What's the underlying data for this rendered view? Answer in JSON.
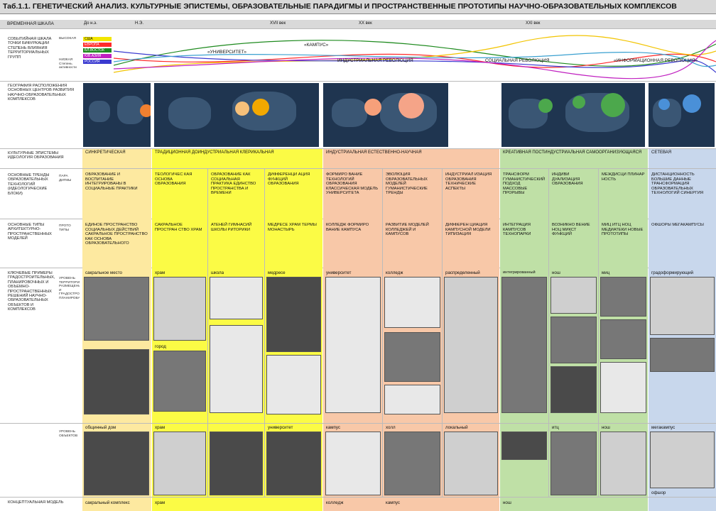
{
  "title": "Таб.1.1. ГЕНЕТИЧЕСКИЙ АНАЛИЗ. КУЛЬТУРНЫЕ ЭПИСТЕМЫ, ОБРАЗОВАТЕЛЬНЫЕ ПАРАДИГМЫ И ПРОСТРАНСТВЕННЫЕ ПРОТОТИПЫ НАУЧНО-ОБРАЗОВАТЕЛЬНЫХ КОМПЛЕКСОВ",
  "timescale": {
    "label": "ВРЕМЕННАЯ ШКАЛА",
    "marks": [
      "До н.э.",
      "Н.Э.",
      "XVII век",
      "XX век",
      "XXI век"
    ]
  },
  "rows": {
    "event": "СОБЫТИЙНАЯ ШКАЛА ТОЧКИ БИФУРКАЦИИ СТЕПЕНЬ ВЛИЯНИЯ ТЕРРИТОРИАЛЬНЫХ ГРУПП",
    "event_high": "ВЫСОКАЯ",
    "event_low": "НИЗКАЯ Степень активности",
    "geo": "ГЕОГРАФИЯ РАСПОЛОЖЕНИЯ ОСНОВНЫХ ЦЕНТРОВ РАЗВИТИЯ НАУЧНО-ОБРАЗОВАТЕЛЬНЫХ КОМПЛЕКСОВ",
    "episteme": "КУЛЬТУРНЫЕ ЭПИСТЕМЫ ИДЕОЛОГИЯ ОБРАЗОВАНИЯ",
    "trends": "ОСНОВНЫЕ ТРЕНДЫ ОБРАЗОВАТЕЛЬНЫХ ТЕХНОЛОГИЙ (ИДЕОЛОГИЧЕСКИЕ БЛОКИ)",
    "trends_sub": "ПАРА ДИГМЫ",
    "types": "ОСНОВНЫЕ ТИПЫ АРХИТЕКТУРНО-ПРОСТРАНСТВЕННЫХ МОДЕЛЕЙ",
    "types_sub": "ПРОТО ТИПЫ",
    "examples": "КЛЮЧЕВЫЕ ПРИМЕРЫ ГРАДОСТРОИТЕЛЬНЫХ, ПЛАНИРОВОЧНЫХ И ОБЪЕМНО-ПРОСТРАНСТВЕННЫХ РЕШЕНИЙ НАУЧНО-ОБРАЗОВАТЕЛЬНЫХ ОБЪЕКТОВ И КОМПЛЕКСОВ",
    "examples_sub1": "УРОВЕНЬ ТЕРРИТОРИАЛЬНОГО РАЗМЕЩЕНИЯ И ГРАДОСТРОИТЕЛЬНОГО ПЛАНИРОВАНИЯ",
    "examples_sub2": "УРОВЕНЬ ОБЪЕКТОВ",
    "concept": "КОНЦЕПТУАЛЬНАЯ МОДЕЛЬ"
  },
  "legend": [
    "США",
    "ЕВРОПА",
    "БЛ.ВОСТОК",
    "ЮВ.АЗИЯ",
    "РОССИЯ"
  ],
  "legend_colors": [
    "#f2e600",
    "#ff2a2a",
    "#1e8a1e",
    "#c020c0",
    "#3a3ad0"
  ],
  "event_labels": [
    "«УНИВЕРСИТЕТ»",
    "«КАМПУС»",
    "ИНДУСТРИАЛЬНАЯ РЕВОЛЮЦИЯ",
    "СОЦИАЛЬНАЯ РЕВОЛЮЦИЯ",
    "«ИНФОРМАЦИОННАЯ РЕВОЛЮЦИЯ»"
  ],
  "epistemes": [
    "СИНКРЕТИЧЕСКАЯ",
    "ТРАДИЦИОННАЯ ДОИНДУСТРИАЛЬНАЯ КЛЕРИКАЛЬНАЯ",
    "ИНДУСТРИАЛЬНАЯ ЕСТЕСТВЕННО-НАУЧНАЯ",
    "КРЕАТИВНАЯ ПОСТИНДУСТРИАЛЬНАЯ САМООРГАНИЗУЮЩАЯСЯ",
    "СЕТЕВАЯ"
  ],
  "trends": [
    "ОБРАЗОВАНИЕ И ВОСПИТАНИЕ ИНТЕГРИРОВАНЫ В СОЦИАЛЬНЫЕ ПРАКТИКИ",
    "ТЕОЛОГИЧЕС КАЯ ОСНОВА ОБРАЗОВАНИЯ",
    "ОБРАЗОВАНИЕ КАК СОЦИАЛЬНАЯ ПРАКТИКА ЕДИНСТВО ПРОСТРАНСТВА И ВРЕМЕНИ",
    "ДИФФЕРЕНЦИ АЦИЯ ФУНКЦИЙ ОБРАЗОВАНИЯ",
    "ФОРМИРО ВАНИЕ ТЕХНОЛОГИЙ ОБРАЗОВАНИЯ КЛАССИЧЕСКАЯ МОДЕЛЬ УНИВЕРСИТЕТА",
    "ЭВОЛЮЦИЯ ОБРАЗОВАТЕЛЬНЫХ МОДЕЛЕЙ ГУМАНИСТИЧЕСКИЕ ТРЕНДЫ",
    "ИНДУСТРИАЛ ИЗАЦИЯ ОБРАЗОВАНИЯ ТЕХНИЧЕСКИЕ АСПЕКТЫ",
    "ТРАНСФОРМ ГУМАНИСТИЧЕСКИЙ ПОДХОД МАССОВЫЕ ПРОРЫВЫ",
    "ИНДИВИ ДУАЛИЗАЦИЯ ОБРАЗОВАНИЯ",
    "МЕЖДИСЦИ ПЛИНАР НОСТЬ",
    "ДИСТАНЦИОННОСТЬ БОЛЬШИЕ ДАННЫЕ ТРАНСФОРМАЦИЯ ОБРАЗОВАТЕЛЬНЫХ ТЕХНОЛОГИЙ СИНЕРГИЯ"
  ],
  "prototypes": [
    "ЕДИНОЕ ПРОСТРАНСТВО СОЦИАЛЬНЫХ ДЕЙСТВИЙ САКРАЛЬНОЕ ПРОСТРАНСТВО КАК ОСНОВА ОБРАЗОВАТЕЛЬНОГО",
    "САКРАЛЬНОЕ ПРОСТРАН СТВО ХРАМ",
    "АТЕНЕЙ ГИМНАСИЙ ШКОЛЫ РИТОРИКИ",
    "МЕДРЕСЕ ХРАМ ТЕРМЫ МОНАСТЫРЬ",
    "КОЛЛЕДЖ ФОРМИРО ВАНИЕ КАМПУСА",
    "РАЗВИТИЕ МОДЕЛЕЙ КОЛЛЕДЖЕЙ И КАМПУСОВ",
    "ДИФФЕРЕН ЦИАЦИЯ КАМПУСНОЙ МОДЕЛИ ТИПИЗАЦИЯ",
    "ИНТЕГРАЦИЯ КАМПУСОВ ТЕХНОПАРКИ",
    "ВОЗНИКНО ВЕНИЕ НОЦ МИКСТ ФУНКЦИЙ",
    "МИЦ ИТЦ НОЦ МЕДИАТЕКИ НОВЫЕ ПРОТОТИПЫ",
    "ОФШОРЫ МЕГАКАМПУСЫ"
  ],
  "cap_top": [
    "сакральное место",
    "храм",
    "школа",
    "медресе",
    "университет",
    "колледж",
    "распределенный",
    "интегрированный",
    "нош",
    "миц",
    "градоформирующий"
  ],
  "cap_mid": [
    "город"
  ],
  "cap_bottom": [
    "общинный дом",
    "храм",
    "",
    "университет",
    "кампус",
    "холл",
    "локальный",
    "",
    "итц",
    "нош",
    "мегакампус"
  ],
  "cap_bottom_extra": [
    "офшор"
  ],
  "concept": [
    "сакральный комплекс",
    "храм",
    "колледж",
    "кампус",
    "нош"
  ]
}
